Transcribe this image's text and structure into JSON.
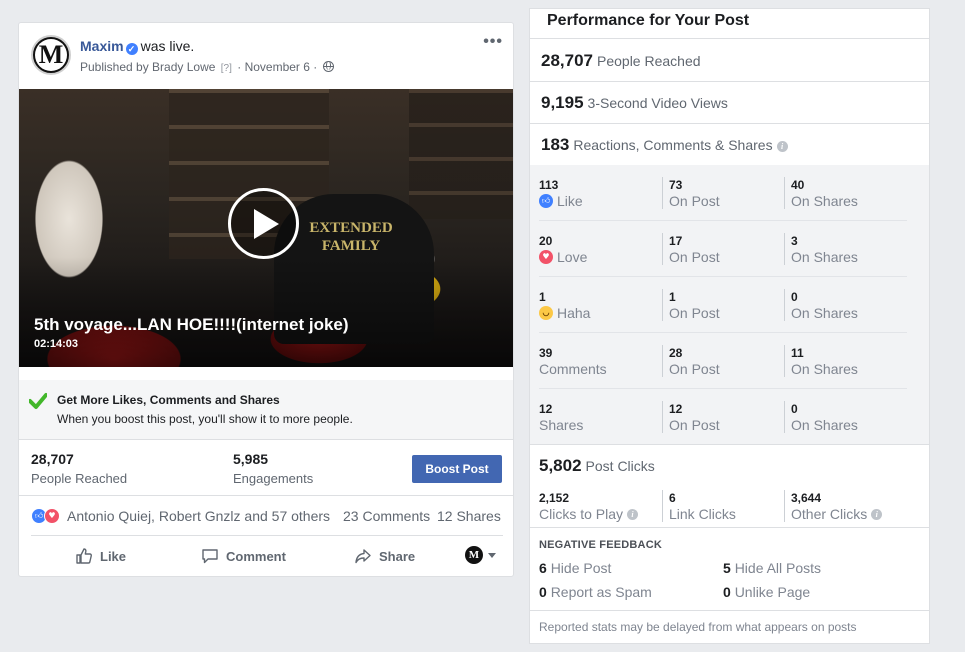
{
  "post": {
    "author": "Maxim",
    "avatar_letter": "M",
    "status_text": "was live.",
    "published_by": "Published by Brady Lowe",
    "help_mark": "[?]",
    "date": "· November 6 ·",
    "more_menu": "•••",
    "video": {
      "title": "5th voyage...LAN HOE!!!!(internet joke)",
      "duration": "02:14:03",
      "shirt_text": "EXTENDED FAMILY"
    },
    "boost_banner": {
      "title": "Get More Likes, Comments and Shares",
      "subtitle": "When you boost this post, you'll show it to more people."
    },
    "stats": {
      "reached_value": "28,707",
      "reached_label": "People Reached",
      "engagements_value": "5,985",
      "engagements_label": "Engagements",
      "boost_button": "Boost Post"
    },
    "reactions_summary": {
      "reactors": "Antonio Quiej, Robert Gnzlz and 57 others",
      "comments": "23 Comments",
      "shares": "12 Shares"
    },
    "actions": {
      "like": "Like",
      "comment": "Comment",
      "share": "Share",
      "page_selector_letter": "M"
    }
  },
  "performance": {
    "title": "Performance for Your Post",
    "kpis": [
      {
        "value": "28,707",
        "label": "People Reached"
      },
      {
        "value": "9,195",
        "label": "3-Second Video Views"
      },
      {
        "value": "183",
        "label": "Reactions, Comments & Shares"
      }
    ],
    "breakdown": [
      {
        "c1_num": "113",
        "c1_label": "Like",
        "c2_num": "73",
        "c2_label": "On Post",
        "c3_num": "40",
        "c3_label": "On Shares"
      },
      {
        "c1_num": "20",
        "c1_label": "Love",
        "c2_num": "17",
        "c2_label": "On Post",
        "c3_num": "3",
        "c3_label": "On Shares"
      },
      {
        "c1_num": "1",
        "c1_label": "Haha",
        "c2_num": "1",
        "c2_label": "On Post",
        "c3_num": "0",
        "c3_label": "On Shares"
      },
      {
        "c1_num": "39",
        "c1_label": "Comments",
        "c2_num": "28",
        "c2_label": "On Post",
        "c3_num": "11",
        "c3_label": "On Shares"
      },
      {
        "c1_num": "12",
        "c1_label": "Shares",
        "c2_num": "12",
        "c2_label": "On Post",
        "c3_num": "0",
        "c3_label": "On Shares"
      }
    ],
    "post_clicks": {
      "value": "5,802",
      "label": "Post Clicks",
      "clicks_to_play_num": "2,152",
      "clicks_to_play_label": "Clicks to Play",
      "link_clicks_num": "6",
      "link_clicks_label": "Link Clicks",
      "other_clicks_num": "3,644",
      "other_clicks_label": "Other Clicks"
    },
    "negative_feedback": {
      "title": "NEGATIVE FEEDBACK",
      "hide_post_num": "6",
      "hide_post_label": "Hide Post",
      "hide_all_num": "5",
      "hide_all_label": "Hide All Posts",
      "spam_num": "0",
      "spam_label": "Report as Spam",
      "unlike_num": "0",
      "unlike_label": "Unlike Page"
    },
    "footnote": "Reported stats may be delayed from what appears on posts"
  },
  "colors": {
    "facebook_blue": "#4267b2",
    "link_blue": "#385898",
    "like_blue": "#4080ff",
    "love_red": "#f25268",
    "haha_yellow": "#fcc846",
    "check_green": "#42b72a"
  },
  "icons": [
    "verified-icon",
    "globe-icon",
    "more-icon",
    "play-icon",
    "check-icon",
    "like-icon",
    "love-icon",
    "haha-icon",
    "comment-icon",
    "share-icon",
    "info-icon",
    "caret-down-icon"
  ]
}
